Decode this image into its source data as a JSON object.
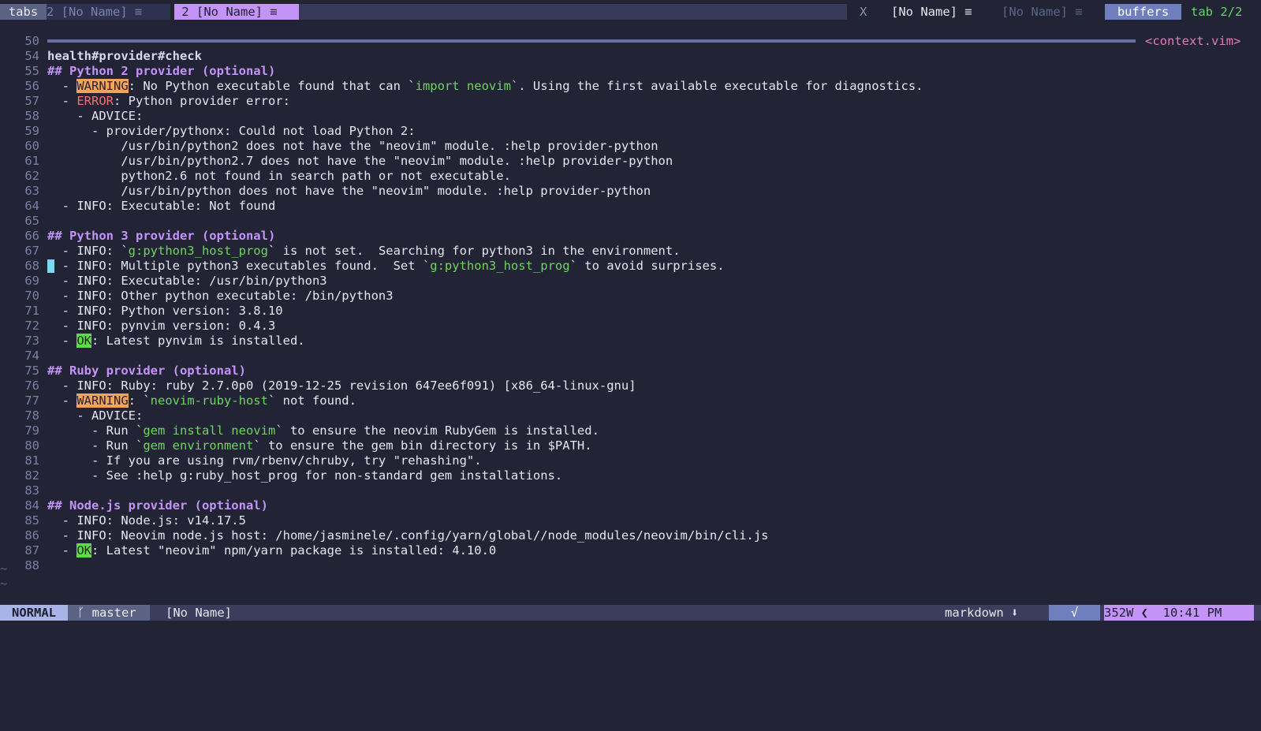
{
  "tabline": {
    "tabs_label": "tabs",
    "tab1": "2 [No Name] ≡",
    "tab2": " 2 [No Name] ≡",
    "close": "X",
    "buffer1": "[No Name] ≡",
    "buffer2": "[No Name] ≡",
    "buffers_label": "buffers",
    "tab_count": "tab 2/2"
  },
  "context": {
    "line_number": "50",
    "text": "health#provider#check",
    "label": "<context.vim>"
  },
  "lines": [
    {
      "n": "54",
      "t": ""
    },
    {
      "n": "55",
      "t": "## Python 2 provider (optional)"
    },
    {
      "n": "56",
      "t": "  - WARNING: No Python executable found that can `import neovim`. Using the first available executable for diagnostics."
    },
    {
      "n": "57",
      "t": "  - ERROR: Python provider error:"
    },
    {
      "n": "58",
      "t": "    - ADVICE:"
    },
    {
      "n": "59",
      "t": "      - provider/pythonx: Could not load Python 2:"
    },
    {
      "n": "60",
      "t": "          /usr/bin/python2 does not have the \"neovim\" module. :help provider-python"
    },
    {
      "n": "61",
      "t": "          /usr/bin/python2.7 does not have the \"neovim\" module. :help provider-python"
    },
    {
      "n": "62",
      "t": "          python2.6 not found in search path or not executable."
    },
    {
      "n": "63",
      "t": "          /usr/bin/python does not have the \"neovim\" module. :help provider-python"
    },
    {
      "n": "64",
      "t": "  - INFO: Executable: Not found"
    },
    {
      "n": "65",
      "t": ""
    },
    {
      "n": "66",
      "t": "## Python 3 provider (optional)"
    },
    {
      "n": "67",
      "t": "  - INFO: `g:python3_host_prog` is not set.  Searching for python3 in the environment."
    },
    {
      "n": "68",
      "t": "  - INFO: Multiple python3 executables found.  Set `g:python3_host_prog` to avoid surprises."
    },
    {
      "n": "69",
      "t": "  - INFO: Executable: /usr/bin/python3"
    },
    {
      "n": "70",
      "t": "  - INFO: Other python executable: /bin/python3"
    },
    {
      "n": "71",
      "t": "  - INFO: Python version: 3.8.10"
    },
    {
      "n": "72",
      "t": "  - INFO: pynvim version: 0.4.3"
    },
    {
      "n": "73",
      "t": "  - OK: Latest pynvim is installed."
    },
    {
      "n": "74",
      "t": ""
    },
    {
      "n": "75",
      "t": "## Ruby provider (optional)"
    },
    {
      "n": "76",
      "t": "  - INFO: Ruby: ruby 2.7.0p0 (2019-12-25 revision 647ee6f091) [x86_64-linux-gnu]"
    },
    {
      "n": "77",
      "t": "  - WARNING: `neovim-ruby-host` not found."
    },
    {
      "n": "78",
      "t": "    - ADVICE:"
    },
    {
      "n": "79",
      "t": "      - Run `gem install neovim` to ensure the neovim RubyGem is installed."
    },
    {
      "n": "80",
      "t": "      - Run `gem environment` to ensure the gem bin directory is in $PATH."
    },
    {
      "n": "81",
      "t": "      - If you are using rvm/rbenv/chruby, try \"rehashing\"."
    },
    {
      "n": "82",
      "t": "      - See :help g:ruby_host_prog for non-standard gem installations."
    },
    {
      "n": "83",
      "t": ""
    },
    {
      "n": "84",
      "t": "## Node.js provider (optional)"
    },
    {
      "n": "85",
      "t": "  - INFO: Node.js: v14.17.5"
    },
    {
      "n": "86",
      "t": "  - INFO: Neovim node.js host: /home/jasminele/.config/yarn/global//node_modules/neovim/bin/cli.js"
    },
    {
      "n": "87",
      "t": "  - OK: Latest \"neovim\" npm/yarn package is installed: 4.10.0"
    },
    {
      "n": "88",
      "t": ""
    }
  ],
  "cursor_line": "68",
  "statusline": {
    "mode": "NORMAL",
    "branch": "ᚴ master",
    "file": "[No Name]",
    "filetype": "markdown ⬇",
    "encoding": "√",
    "word_count": "352W ❮  10:41 PM"
  },
  "colors": {
    "background": "#222436",
    "heading": "#c393f7",
    "warning_bg": "#f4a35b",
    "error": "#ff6b6b",
    "ok_bg": "#5cde4a",
    "code": "#6fd45e"
  }
}
